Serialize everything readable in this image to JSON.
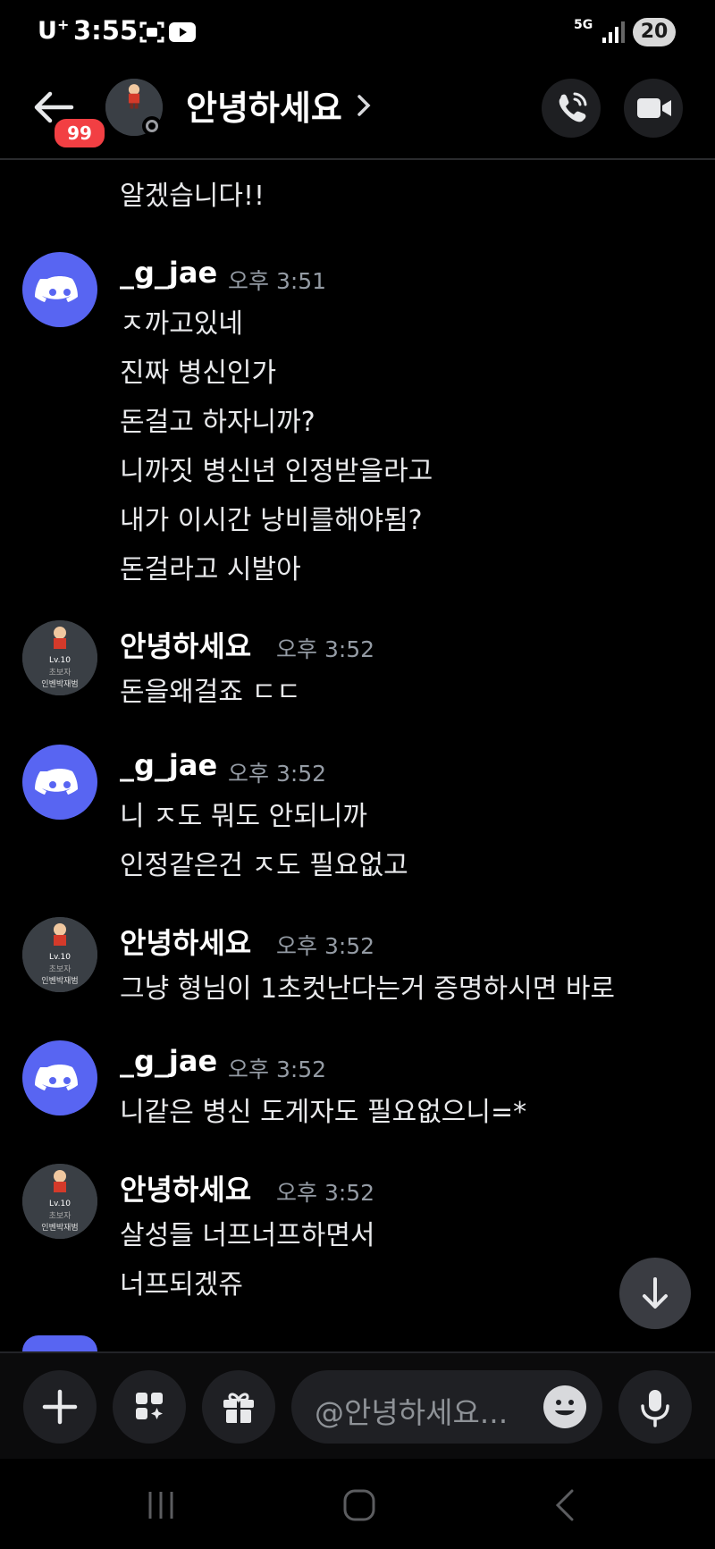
{
  "status_bar": {
    "carrier": "U",
    "carrier_sup": "+",
    "time": "3:55",
    "network": "5G",
    "battery": "20"
  },
  "header": {
    "unread_count": "99",
    "channel_name": "안녕하세요",
    "icons": [
      "back-arrow-icon",
      "chevron-right-icon",
      "phone-call-icon",
      "video-camera-icon"
    ]
  },
  "messages": {
    "cont": {
      "lines": [
        "알겠습니다!!"
      ]
    },
    "g1": {
      "author": "_g_jae",
      "time": "오후 3:51",
      "lines": [
        "ㅈ까고있네",
        "진짜 병신인가",
        "돈걸고 하자니까?",
        "니까짓 병신년 인정받을라고",
        "내가 이시간 낭비를해야됨?",
        "돈걸라고 시발아"
      ]
    },
    "g2": {
      "author": "안녕하세요",
      "time": "오후 3:52",
      "lines": [
        "돈을왜걸죠 ㄷㄷ"
      ]
    },
    "g3": {
      "author": "_g_jae",
      "time": "오후 3:52",
      "lines": [
        "니 ㅈ도 뭐도 안되니까",
        "인정같은건 ㅈ도 필요없고"
      ]
    },
    "g4": {
      "author": "안녕하세요",
      "time": "오후 3:52",
      "lines": [
        "그냥 형님이 1초컷난다는거 증명하시면 바로"
      ]
    },
    "g5": {
      "author": "_g_jae",
      "time": "오후 3:52",
      "lines": [
        "니같은 병신 도게자도 필요없으니=*"
      ]
    },
    "g6": {
      "author": "안녕하세요",
      "time": "오후 3:52",
      "lines": [
        "살성들 너프너프하면서",
        "너프되겠쥬"
      ]
    }
  },
  "avatar_badge": {
    "level": "Lv.10",
    "title": "초보자",
    "name": "인벤박재범"
  },
  "composer": {
    "placeholder": "@안녕하세요...",
    "icons": [
      "plus-icon",
      "apps-icon",
      "gift-icon",
      "emoji-icon",
      "microphone-icon"
    ]
  },
  "colors": {
    "background": "#000000",
    "discord_blurple": "#5865f2",
    "badge_red": "#f23f43",
    "timestamp": "#949ba4"
  }
}
